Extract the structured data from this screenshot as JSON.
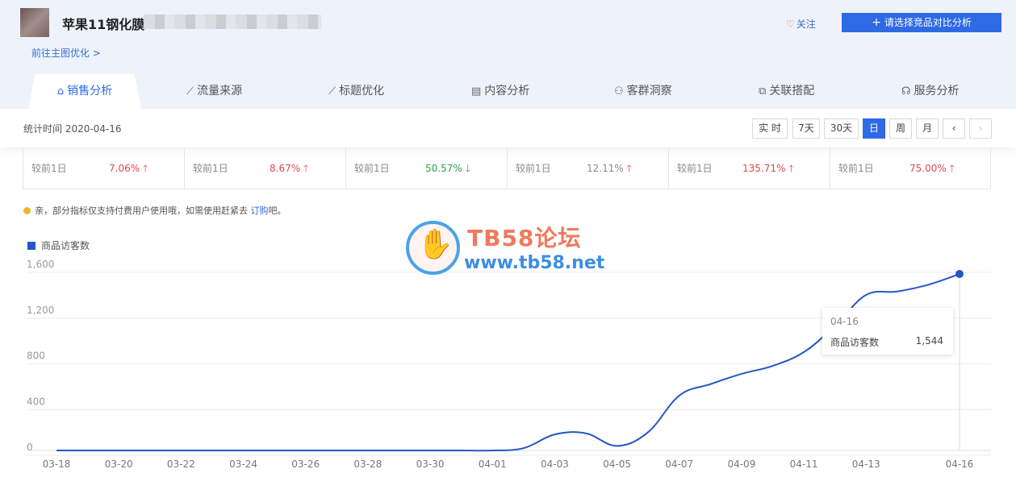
{
  "header": {
    "product_title": "苹果11钢化膜",
    "link_main": "前往主图优化 >",
    "follow_label": "关注",
    "compare_label": "请选择竞品对比分析"
  },
  "tabs": [
    {
      "label": "销售分析",
      "icon": "bag-icon",
      "active": true
    },
    {
      "label": "流量来源",
      "icon": "line-chart-icon"
    },
    {
      "label": "标题优化",
      "icon": "trend-icon"
    },
    {
      "label": "内容分析",
      "icon": "document-icon"
    },
    {
      "label": "客群洞察",
      "icon": "users-icon"
    },
    {
      "label": "关联搭配",
      "icon": "link-icon"
    },
    {
      "label": "服务分析",
      "icon": "headset-icon"
    }
  ],
  "toolbar": {
    "stat_time": "统计时间 2020-04-16",
    "buttons": [
      "实 时",
      "7天",
      "30天",
      "日",
      "周",
      "月"
    ],
    "active_button": "日"
  },
  "metrics": [
    {
      "label": "较前1日",
      "value": "7.06%",
      "direction": "up"
    },
    {
      "label": "较前1日",
      "value": "8.67%",
      "direction": "up"
    },
    {
      "label": "较前1日",
      "value": "50.57%",
      "direction": "down"
    },
    {
      "label": "较前1日",
      "value": "12.11%",
      "direction": "up-gray"
    },
    {
      "label": "较前1日",
      "value": "135.71%",
      "direction": "up"
    },
    {
      "label": "较前1日",
      "value": "75.00%",
      "direction": "up"
    }
  ],
  "notice": {
    "text_before": "亲，部分指标仅支持付费用户使用哦，如需使用赶紧去 ",
    "link": "订购",
    "text_after": "吧。"
  },
  "watermark": {
    "line1": "TB58论坛",
    "line2": "www.tb58.net"
  },
  "colors": {
    "accent": "#2e6ae6",
    "series": "#2457c5",
    "up": "#e0474c",
    "down": "#2aa146"
  },
  "chart_data": {
    "type": "line",
    "series": [
      {
        "name": "商品访客数",
        "x": [
          "03-18",
          "03-19",
          "03-20",
          "03-21",
          "03-22",
          "03-23",
          "03-24",
          "03-25",
          "03-26",
          "03-27",
          "03-28",
          "03-29",
          "03-30",
          "03-31",
          "04-01",
          "04-02",
          "04-03",
          "04-04",
          "04-05",
          "04-06",
          "04-07",
          "04-08",
          "04-09",
          "04-10",
          "04-11",
          "04-12",
          "04-13",
          "04-14",
          "04-15",
          "04-16"
        ],
        "values": [
          0,
          0,
          0,
          0,
          0,
          0,
          0,
          0,
          0,
          0,
          0,
          0,
          0,
          0,
          0,
          20,
          140,
          150,
          40,
          160,
          480,
          580,
          670,
          740,
          860,
          1090,
          1360,
          1390,
          1450,
          1544
        ]
      }
    ],
    "x_ticks": [
      "03-18",
      "03-20",
      "03-22",
      "03-24",
      "03-26",
      "03-28",
      "03-30",
      "04-01",
      "04-03",
      "04-05",
      "04-07",
      "04-09",
      "04-11",
      "04-13",
      "04-16"
    ],
    "y_ticks": [
      0,
      400,
      800,
      1200,
      1600
    ],
    "ylim": [
      0,
      1600
    ],
    "grid": true,
    "legend": "top-left",
    "tooltip": {
      "date": "04-16",
      "name": "商品访客数",
      "value": "1,544"
    }
  }
}
